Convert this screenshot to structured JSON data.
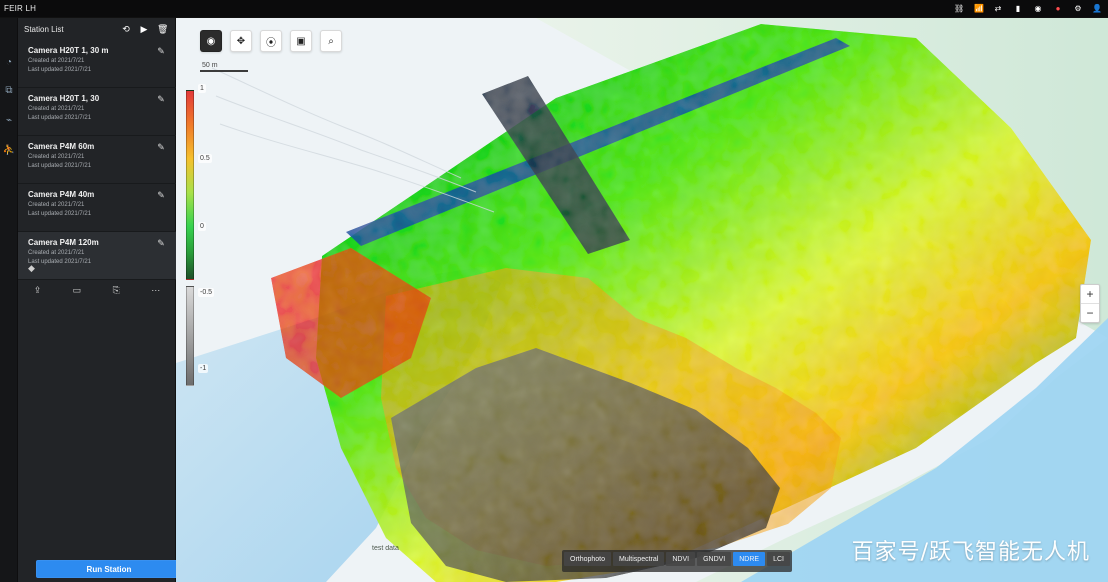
{
  "topbar": {
    "title": "FEIR LH",
    "right_groups": [
      {
        "label": "",
        "icon": "status-icon"
      },
      {
        "label": "",
        "icon": "signal-icon"
      },
      {
        "label": "",
        "icon": "network-icon"
      },
      {
        "label": "",
        "icon": "battery-icon"
      },
      {
        "label": "",
        "icon": "record-icon"
      },
      {
        "label": "",
        "icon": "alert-icon"
      }
    ]
  },
  "sidebar": {
    "header": "Station List",
    "items": [
      {
        "name": "Camera H20T 1, 30 m",
        "meta1": "Created at 2021/7/21",
        "meta2": "Last updated 2021/7/21",
        "active": false
      },
      {
        "name": "Camera H20T 1, 30",
        "meta1": "Created at 2021/7/21",
        "meta2": "Last updated 2021/7/21",
        "active": false
      },
      {
        "name": "Camera P4M 60m",
        "meta1": "Created at 2021/7/21",
        "meta2": "Last updated 2021/7/21",
        "active": false
      },
      {
        "name": "Camera P4M 40m",
        "meta1": "Created at 2021/7/21",
        "meta2": "Last updated 2021/7/21",
        "active": false
      },
      {
        "name": "Camera P4M 120m",
        "meta1": "Created at 2021/7/21",
        "meta2": "Last updated 2021/7/21",
        "active": true
      }
    ],
    "bottom_button": "Run Station"
  },
  "map": {
    "scale": "50 m",
    "legend": {
      "top": "1",
      "mid": "0.5",
      "mid2": "0",
      "low": "-0.5",
      "bottom": "-1"
    },
    "map_label": "test data",
    "tabs": [
      {
        "label": "Orthophoto",
        "active": false
      },
      {
        "label": "Multispectral",
        "active": false
      },
      {
        "label": "NDVI",
        "active": false
      },
      {
        "label": "GNDVI",
        "active": false
      },
      {
        "label": "NDRE",
        "active": true
      },
      {
        "label": "LCI",
        "active": false
      }
    ],
    "watermark": "百家号/跃飞智能无人机"
  }
}
